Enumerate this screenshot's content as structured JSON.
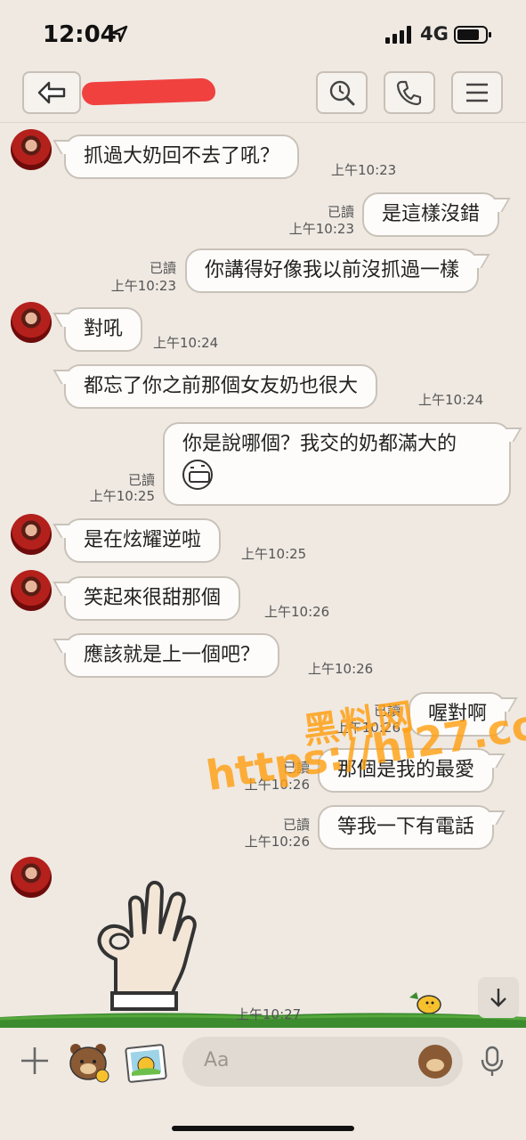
{
  "status": {
    "time": "12:04",
    "network": "4G"
  },
  "header": {
    "back": "back",
    "search": "search",
    "call": "call",
    "menu": "menu"
  },
  "messages": [
    {
      "id": 1,
      "side": "in",
      "text": "抓過大奶回不去了吼？",
      "time": "上午10:23"
    },
    {
      "id": 2,
      "side": "out",
      "read": "已讀",
      "text": "是這樣沒錯",
      "time": "上午10:23"
    },
    {
      "id": 3,
      "side": "out",
      "read": "已讀",
      "text": "你講得好像我以前沒抓過一樣",
      "time": "上午10:23"
    },
    {
      "id": 4,
      "side": "in",
      "text": "對吼",
      "time": "上午10:24"
    },
    {
      "id": 5,
      "side": "in",
      "text": "都忘了你之前那個女友奶也很大",
      "time": "上午10:24"
    },
    {
      "id": 6,
      "side": "out",
      "read": "已讀",
      "text": "你是說哪個？我交的奶都滿大的",
      "time": "上午10:25"
    },
    {
      "id": 7,
      "side": "in",
      "text": "是在炫耀逆啦",
      "time": "上午10:25"
    },
    {
      "id": 8,
      "side": "in",
      "text": "笑起來很甜那個",
      "time": "上午10:26"
    },
    {
      "id": 9,
      "side": "in",
      "text": "應該就是上一個吧？",
      "time": "上午10:26"
    },
    {
      "id": 10,
      "side": "out",
      "read": "已讀",
      "text": "喔對啊",
      "time": "上午10:26"
    },
    {
      "id": 11,
      "side": "out",
      "read": "已讀",
      "text": "那個是我的最愛",
      "time": "上午10:26"
    },
    {
      "id": 12,
      "side": "out",
      "read": "已讀",
      "text": "等我一下有電話",
      "time": "上午10:26"
    },
    {
      "id": 13,
      "side": "in",
      "sticker": "ok-hand-sticker",
      "time": "上午10:27"
    }
  ],
  "watermark": {
    "line1": "黑料网",
    "line2": "https://hl27.co"
  },
  "input": {
    "placeholder": "Aa"
  },
  "colors": {
    "background": "#efe9e2",
    "bubble": "#fdfcfa",
    "bubble_border": "#c9c2b9",
    "watermark": "#ffa014",
    "redaction": "#f0413f"
  }
}
